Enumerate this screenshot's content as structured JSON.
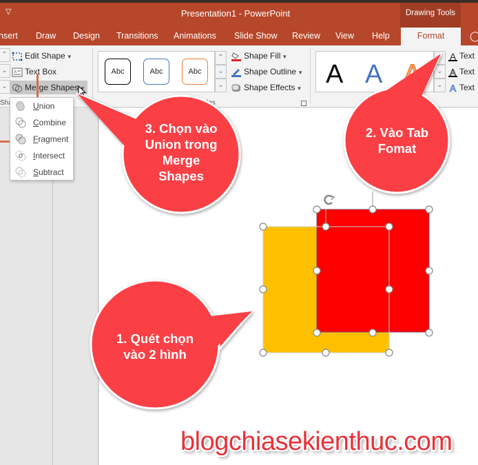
{
  "window": {
    "title": "Presentation1  -  PowerPoint",
    "contextual_tab_group": "Drawing Tools",
    "qat_icon": "customize-qat-icon"
  },
  "tabs": [
    {
      "label": "nsert",
      "active": false
    },
    {
      "label": "Draw",
      "active": false
    },
    {
      "label": "Design",
      "active": false
    },
    {
      "label": "Transitions",
      "active": false
    },
    {
      "label": "Animations",
      "active": false
    },
    {
      "label": "Slide Show",
      "active": false
    },
    {
      "label": "Review",
      "active": false
    },
    {
      "label": "View",
      "active": false
    },
    {
      "label": "Help",
      "active": false
    },
    {
      "label": "Format",
      "active": true
    },
    {
      "label": "",
      "icon": "lightbulb-icon",
      "active": false
    }
  ],
  "ribbon": {
    "insert_shapes": {
      "edit_shape": "Edit Shape",
      "text_box": "Text Box",
      "merge_shapes": "Merge Shapes",
      "group_label_partial": "Sha"
    },
    "shape_styles": {
      "gallery": [
        {
          "label": "Abc",
          "border": "#000000"
        },
        {
          "label": "Abc",
          "border": "#4472c4"
        },
        {
          "label": "Abc",
          "border": "#ed7d31"
        }
      ],
      "group_label_partial": "les",
      "shape_fill": "Shape Fill",
      "shape_outline": "Shape Outline",
      "shape_effects": "Shape Effects"
    },
    "wordart_styles": {
      "gallery": [
        {
          "label": "A",
          "color": "#000000"
        },
        {
          "label": "A",
          "color": "#4472c4"
        },
        {
          "label": "A",
          "color": "#ed7d31"
        }
      ],
      "text_fill": "Text",
      "text_outline": "Text",
      "text_effects": "Text"
    }
  },
  "merge_menu": {
    "items": [
      {
        "label": "Union",
        "accel": "U",
        "rest": "nion",
        "icon": "union-icon"
      },
      {
        "label": "Combine",
        "accel": "C",
        "rest": "ombine",
        "icon": "combine-icon"
      },
      {
        "label": "Fragment",
        "accel": "F",
        "rest": "ragment",
        "icon": "fragment-icon"
      },
      {
        "label": "Intersect",
        "accel": "I",
        "rest": "ntersect",
        "icon": "intersect-icon"
      },
      {
        "label": "Subtract",
        "accel": "S",
        "rest": "ubtract",
        "icon": "subtract-icon"
      }
    ]
  },
  "slide": {
    "shapes": [
      {
        "name": "yellow-rectangle",
        "fill": "#ffc000"
      },
      {
        "name": "red-rectangle",
        "fill": "#ff0000"
      }
    ]
  },
  "callouts": [
    {
      "step": 1,
      "text_lines": [
        "1. Quét chọn",
        "vào 2 hình"
      ]
    },
    {
      "step": 2,
      "text_lines": [
        "2. Vào Tab",
        "Fomat"
      ]
    },
    {
      "step": 3,
      "text_lines": [
        "3. Chọn vào",
        "Union trong",
        "Merge",
        "Shapes"
      ]
    }
  ],
  "colors": {
    "accent": "#b7472a",
    "callout": "#fa3f44"
  },
  "watermark": "blogchiasekienthuc.com"
}
